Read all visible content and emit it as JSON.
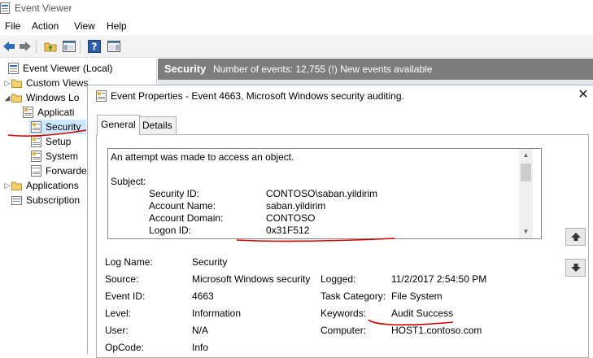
{
  "window": {
    "title": "Event Viewer"
  },
  "menu": [
    "File",
    "Action",
    "View",
    "Help"
  ],
  "tree": {
    "root": "Event Viewer (Local)",
    "custom_views": "Custom Views",
    "windows_logs": "Windows Lo",
    "application": "Applicati",
    "security": "Security",
    "setup": "Setup",
    "system": "System",
    "forwarded": "Forwarde",
    "apps_services": "Applications",
    "subscriptions": "Subscription"
  },
  "header": {
    "title": "Security",
    "info": "Number of events: 12,755 (!) New events available"
  },
  "dialog": {
    "title": "Event Properties - Event 4663, Microsoft Windows security auditing.",
    "tabs": [
      "General",
      "Details"
    ],
    "description": {
      "intro": "An attempt was made to access an object.",
      "subject_label": "Subject:",
      "rows": [
        {
          "label": "Security ID:",
          "value": "CONTOSO\\saban.yildirim"
        },
        {
          "label": "Account Name:",
          "value": "saban.yildirim"
        },
        {
          "label": "Account Domain:",
          "value": "CONTOSO"
        },
        {
          "label": "Logon ID:",
          "value": "0x31F512"
        }
      ]
    },
    "fields": {
      "log_name_label": "Log Name:",
      "log_name": "Security",
      "source_label": "Source:",
      "source": "Microsoft Windows security",
      "logged_label": "Logged:",
      "logged": "11/2/2017 2:54:50 PM",
      "event_id_label": "Event ID:",
      "event_id": "4663",
      "task_category_label": "Task Category:",
      "task_category": "File System",
      "level_label": "Level:",
      "level": "Information",
      "keywords_label": "Keywords:",
      "keywords": "Audit Success",
      "user_label": "User:",
      "user": "N/A",
      "computer_label": "Computer:",
      "computer": "HOST1.contoso.com",
      "opcode_label": "OpCode:",
      "opcode": "Info"
    }
  },
  "colors": {
    "header_bg": "#7d7d7d",
    "selection": "#cce8ff",
    "annotation_red": "#d40000"
  }
}
